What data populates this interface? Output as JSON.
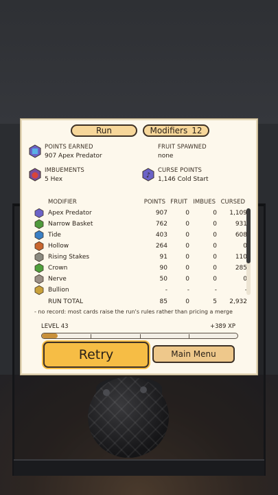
{
  "tabs": {
    "run_label": "Run",
    "modifiers_label": "Modifiers",
    "modifiers_count": "12"
  },
  "stats": {
    "points_earned_label": "POINTS EARNED",
    "points_earned_value": "907  Apex Predator",
    "fruit_spawned_label": "FRUIT SPAWNED",
    "fruit_spawned_value": "none",
    "imbuements_label": "IMBUEMENTS",
    "imbuements_value": "5 Hex",
    "curse_points_label": "CURSE POINTS",
    "curse_points_value": "1,146  Cold Start"
  },
  "table": {
    "headers": {
      "modifier": "MODIFIER",
      "points": "POINTS",
      "fruit": "FRUIT",
      "imbues": "IMBUES",
      "cursed": "CURSED"
    },
    "rows": [
      {
        "name": "Apex Predator",
        "points": "907",
        "fruit": "0",
        "imbues": "0",
        "cursed": "1,109",
        "icon": "apex-predator-icon",
        "color": "#6b63c7"
      },
      {
        "name": "Narrow Basket",
        "points": "762",
        "fruit": "0",
        "imbues": "0",
        "cursed": "931",
        "icon": "narrow-basket-icon",
        "color": "#4f9a3c"
      },
      {
        "name": "Tide",
        "points": "403",
        "fruit": "0",
        "imbues": "0",
        "cursed": "608",
        "icon": "tide-icon",
        "color": "#3a7fc4"
      },
      {
        "name": "Hollow",
        "points": "264",
        "fruit": "0",
        "imbues": "0",
        "cursed": "0",
        "icon": "hollow-icon",
        "color": "#c8662e"
      },
      {
        "name": "Rising Stakes",
        "points": "91",
        "fruit": "0",
        "imbues": "0",
        "cursed": "110",
        "icon": "rising-stakes-icon",
        "color": "#8a8a80"
      },
      {
        "name": "Crown",
        "points": "90",
        "fruit": "0",
        "imbues": "0",
        "cursed": "285",
        "icon": "crown-icon",
        "color": "#4fa03c"
      },
      {
        "name": "Nerve",
        "points": "50",
        "fruit": "0",
        "imbues": "0",
        "cursed": "0",
        "icon": "nerve-icon",
        "color": "#9a8f86"
      },
      {
        "name": "Bullion",
        "points": "-",
        "fruit": "-",
        "imbues": "-",
        "cursed": "-",
        "icon": "bullion-icon",
        "color": "#c9a13a"
      }
    ],
    "total": {
      "label": "RUN TOTAL",
      "points": "85",
      "fruit": "0",
      "imbues": "5",
      "cursed": "2,932"
    }
  },
  "note": "-  no record: most cards raise the run's rules rather than pricing a merge",
  "progress": {
    "level_label": "LEVEL 43",
    "xp_label": "+389 XP",
    "fraction": 0.08
  },
  "buttons": {
    "retry": "Retry",
    "main_menu": "Main Menu"
  },
  "colors": {
    "panel": "#fdf8ec",
    "accent": "#f6bd45",
    "tab": "#f7d79a"
  }
}
